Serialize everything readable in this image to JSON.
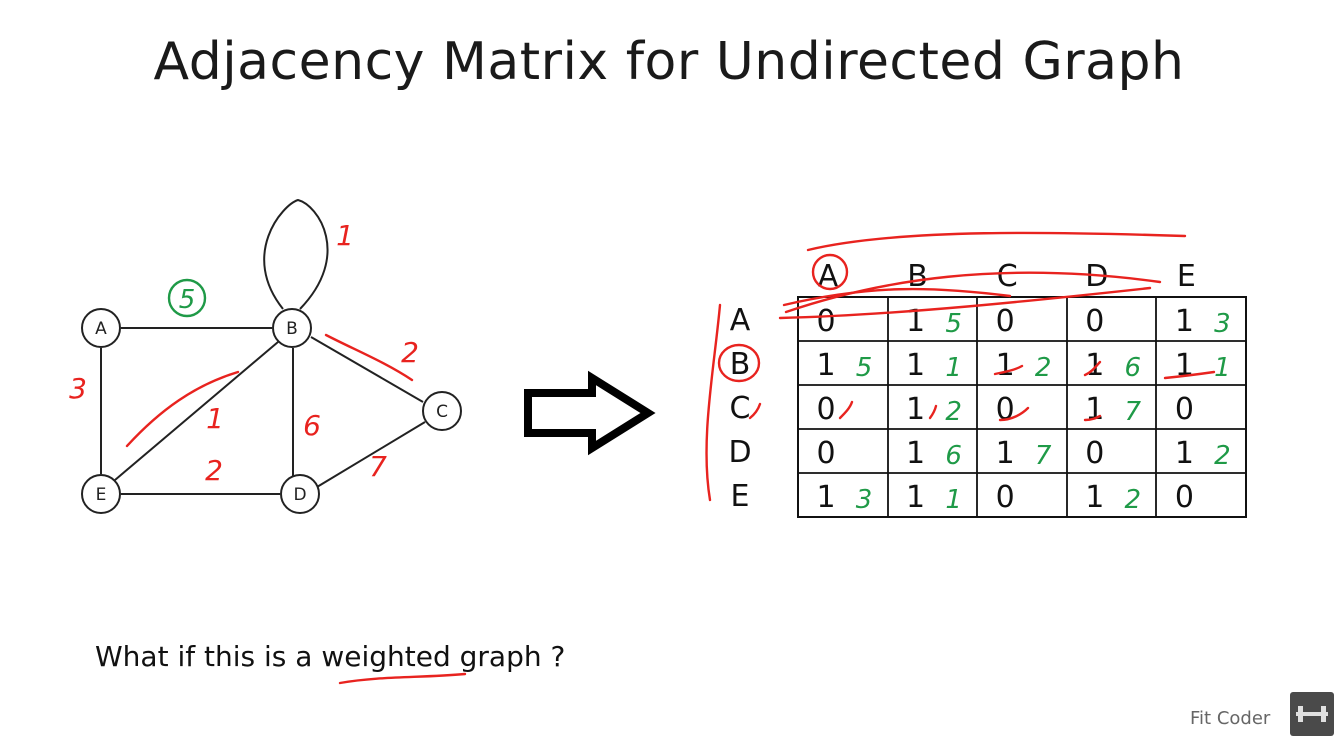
{
  "title": "Adjacency Matrix for Undirected Graph",
  "question": "What if this is a weighted graph ?",
  "brand": {
    "text": "Fit Coder"
  },
  "colors": {
    "annotation_red": "#e8231f",
    "annotation_green": "#1f9a47",
    "ink": "#111111"
  },
  "graph": {
    "nodes": [
      "A",
      "B",
      "C",
      "D",
      "E"
    ],
    "edges": [
      {
        "from": "A",
        "to": "B",
        "weight": "5"
      },
      {
        "from": "A",
        "to": "E",
        "weight": "3"
      },
      {
        "from": "B",
        "to": "B",
        "weight": "1"
      },
      {
        "from": "B",
        "to": "C",
        "weight": "2"
      },
      {
        "from": "B",
        "to": "D",
        "weight": "6"
      },
      {
        "from": "B",
        "to": "E",
        "weight": "1"
      },
      {
        "from": "C",
        "to": "D",
        "weight": "7"
      },
      {
        "from": "E",
        "to": "D",
        "weight": "2"
      }
    ]
  },
  "matrix": {
    "col_headers": [
      "A",
      "B",
      "C",
      "D",
      "E"
    ],
    "row_headers": [
      "A",
      "B",
      "C",
      "D",
      "E"
    ],
    "cells": [
      [
        "0",
        "1",
        "0",
        "0",
        "1"
      ],
      [
        "1",
        "1",
        "1",
        "1",
        "1"
      ],
      [
        "0",
        "1",
        "0",
        "1",
        "0"
      ],
      [
        "0",
        "1",
        "1",
        "0",
        "1"
      ],
      [
        "1",
        "1",
        "0",
        "1",
        "0"
      ]
    ],
    "weights": [
      [
        "",
        "5",
        "",
        "",
        "3"
      ],
      [
        "5",
        "1",
        "2",
        "6",
        "1"
      ],
      [
        "",
        "2",
        "",
        "7",
        ""
      ],
      [
        "",
        "6",
        "7",
        "",
        "2"
      ],
      [
        "3",
        "1",
        "",
        "2",
        ""
      ]
    ]
  }
}
